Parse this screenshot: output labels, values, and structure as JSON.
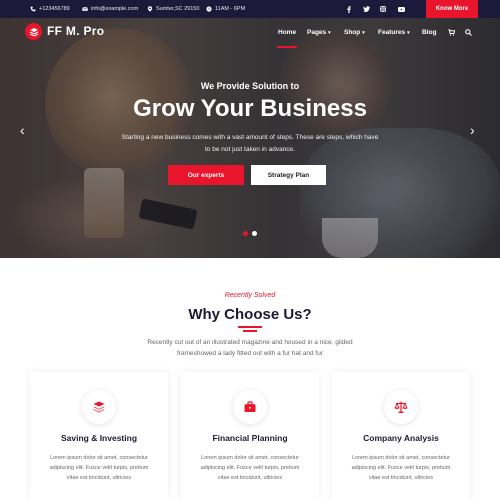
{
  "topbar": {
    "phone": "+123456789",
    "email": "info@example.com",
    "location": "Sumter,SC 29150",
    "hours": "11AM - 6PM",
    "social_icons": [
      "facebook-icon",
      "twitter-icon",
      "instagram-icon",
      "youtube-icon"
    ],
    "cta_label": "Know More"
  },
  "brand": {
    "name": "FF M. Pro"
  },
  "nav": {
    "items": [
      {
        "label": "Home",
        "dropdown": false,
        "active": true
      },
      {
        "label": "Pages",
        "dropdown": true
      },
      {
        "label": "Shop",
        "dropdown": true
      },
      {
        "label": "Features",
        "dropdown": true
      },
      {
        "label": "Blog",
        "dropdown": false
      }
    ]
  },
  "hero": {
    "subtitle": "We Provide Solution to",
    "title": "Grow Your Business",
    "description": "Starting a new business comes with a vast amount of steps. These are steps, which have to be not just taken in advance.",
    "primary_button": "Our experts",
    "secondary_button": "Strategy Plan",
    "slides_total": 2,
    "active_slide": 1
  },
  "section": {
    "eyebrow": "Recently Solved",
    "title": "Why Choose Us?",
    "description": "Recently cut out of an illustrated magazine and housed in a nice, gilded frameshowed a lady fitted out with a fur hat and fur"
  },
  "cards": [
    {
      "icon": "layers-icon",
      "title": "Saving & Investing",
      "body": "Lorem ipsum dolor sit amet, consectetur adipiscing elit. Fusce velit turpis, pretium vitae est tincidunt, ultricies"
    },
    {
      "icon": "briefcase-icon",
      "title": "Financial Planning",
      "body": "Lorem ipsum dolor sit amet, consectetur adipiscing elit. Fusce velit turpis, pretium vitae est tincidunt, ultricies"
    },
    {
      "icon": "scales-icon",
      "title": "Company Analysis",
      "body": "Lorem ipsum dolor sit amet, consectetur adipiscing elit. Fusce velit turpis, pretium vitae est tincidunt, ultricies"
    }
  ],
  "colors": {
    "accent": "#e8152c",
    "topbar_bg": "#1b1a3a",
    "heading": "#1c1b33"
  }
}
